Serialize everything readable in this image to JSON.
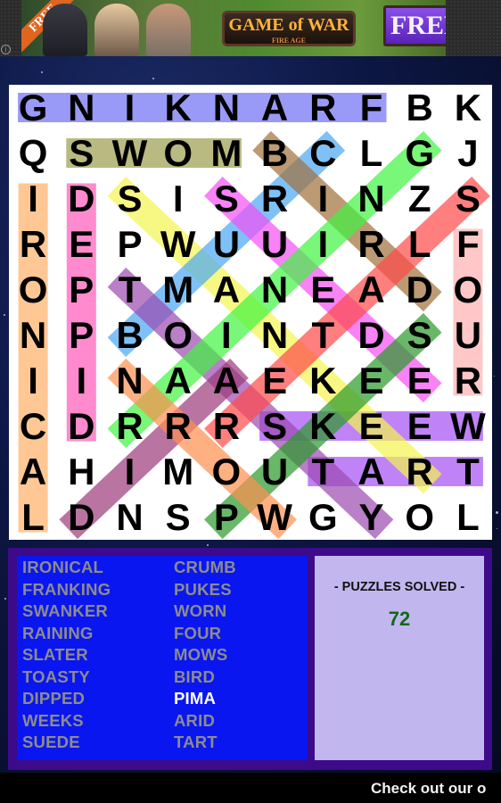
{
  "ad": {
    "ribbon_label": "FREE",
    "logo_title": "GAME of WAR",
    "logo_subtitle": "FIRE AGE",
    "button_label": "FREE",
    "info_icon": "info-icon"
  },
  "grid": {
    "rows": [
      [
        "G",
        "N",
        "I",
        "K",
        "N",
        "A",
        "R",
        "F",
        "B",
        "K"
      ],
      [
        "Q",
        "S",
        "W",
        "O",
        "M",
        "B",
        "C",
        "L",
        "G",
        "J"
      ],
      [
        "I",
        "D",
        "S",
        "I",
        "S",
        "R",
        "I",
        "N",
        "Z",
        "S"
      ],
      [
        "R",
        "E",
        "P",
        "W",
        "U",
        "U",
        "I",
        "R",
        "L",
        "F"
      ],
      [
        "O",
        "P",
        "T",
        "M",
        "A",
        "N",
        "E",
        "A",
        "D",
        "O"
      ],
      [
        "N",
        "P",
        "B",
        "O",
        "I",
        "N",
        "T",
        "D",
        "S",
        "U"
      ],
      [
        "I",
        "I",
        "N",
        "A",
        "A",
        "E",
        "K",
        "E",
        "E",
        "R"
      ],
      [
        "C",
        "D",
        "R",
        "R",
        "R",
        "S",
        "K",
        "E",
        "E",
        "W"
      ],
      [
        "A",
        "H",
        "I",
        "M",
        "O",
        "U",
        "T",
        "A",
        "R",
        "T"
      ],
      [
        "L",
        "D",
        "N",
        "S",
        "P",
        "W",
        "G",
        "Y",
        "O",
        "L"
      ]
    ],
    "found_highlights": [
      {
        "word": "FRANKING",
        "start": [
          0,
          7
        ],
        "end": [
          0,
          0
        ],
        "color": "#6f6ff5"
      },
      {
        "word": "MOWS",
        "start": [
          1,
          4
        ],
        "end": [
          1,
          1
        ],
        "color": "#9c9c4e"
      },
      {
        "word": "IRONICAL",
        "start": [
          2,
          0
        ],
        "end": [
          9,
          0
        ],
        "color": "#ffb068"
      },
      {
        "word": "DIPPED",
        "start": [
          7,
          1
        ],
        "end": [
          2,
          1
        ],
        "color": "#ff5ab8"
      },
      {
        "word": "FOUR",
        "start": [
          3,
          9
        ],
        "end": [
          6,
          9
        ],
        "color": "#ffb0b0"
      },
      {
        "word": "WEEKS",
        "start": [
          7,
          9
        ],
        "end": [
          7,
          5
        ],
        "color": "#a550f5"
      },
      {
        "word": "TART",
        "start": [
          8,
          6
        ],
        "end": [
          8,
          9
        ],
        "color": "#a550f5"
      },
      {
        "word": "SWANKER",
        "start": [
          2,
          2
        ],
        "end": [
          8,
          8
        ],
        "color": "#f5f550"
      },
      {
        "word": "CRUMB",
        "start": [
          1,
          6
        ],
        "end": [
          5,
          2
        ],
        "color": "#4aa8f5"
      },
      {
        "word": "SUEDE",
        "start": [
          2,
          4
        ],
        "end": [
          6,
          8
        ],
        "color": "#f550f5"
      },
      {
        "word": "TOASTY",
        "start": [
          4,
          2
        ],
        "end": [
          9,
          7
        ],
        "color": "#9c4ab0"
      },
      {
        "word": "BIRD",
        "start": [
          1,
          5
        ],
        "end": [
          4,
          8
        ],
        "color": "#a0703a"
      },
      {
        "word": "RAINING",
        "start": [
          7,
          2
        ],
        "end": [
          1,
          8
        ],
        "color": "#40f540"
      },
      {
        "word": "SLATER",
        "start": [
          2,
          9
        ],
        "end": [
          7,
          4
        ],
        "color": "#ff4a4a"
      },
      {
        "word": "PUKES",
        "start": [
          9,
          4
        ],
        "end": [
          5,
          8
        ],
        "color": "#2a9a2a"
      },
      {
        "word": "ARID",
        "start": [
          6,
          4
        ],
        "end": [
          9,
          1
        ],
        "color": "#9c3a7a"
      },
      {
        "word": "WORN",
        "start": [
          9,
          5
        ],
        "end": [
          6,
          2
        ],
        "color": "#ff9050"
      }
    ]
  },
  "word_list": {
    "column_1": [
      {
        "text": "IRONICAL",
        "found": true
      },
      {
        "text": "FRANKING",
        "found": true
      },
      {
        "text": "SWANKER",
        "found": true
      },
      {
        "text": "RAINING",
        "found": true
      },
      {
        "text": "SLATER",
        "found": true
      },
      {
        "text": "TOASTY",
        "found": true
      },
      {
        "text": "DIPPED",
        "found": true
      },
      {
        "text": "WEEKS",
        "found": true
      },
      {
        "text": "SUEDE",
        "found": true
      }
    ],
    "column_2": [
      {
        "text": "CRUMB",
        "found": true
      },
      {
        "text": "PUKES",
        "found": true
      },
      {
        "text": "WORN",
        "found": true
      },
      {
        "text": "FOUR",
        "found": true
      },
      {
        "text": "MOWS",
        "found": true
      },
      {
        "text": "BIRD",
        "found": true
      },
      {
        "text": "PIMA",
        "found": false
      },
      {
        "text": "ARID",
        "found": true
      },
      {
        "text": "TART",
        "found": true
      }
    ]
  },
  "stats": {
    "label": "- PUZZLES SOLVED -",
    "value": "72"
  },
  "ticker": {
    "text": "Check out our o"
  },
  "colors": {
    "found_word": "#8c8c8c",
    "unfound_word": "#ffffff",
    "stats_value": "#0f6a16",
    "panel_border": "#3d0a8a",
    "word_list_bg": "#0a16f0"
  }
}
